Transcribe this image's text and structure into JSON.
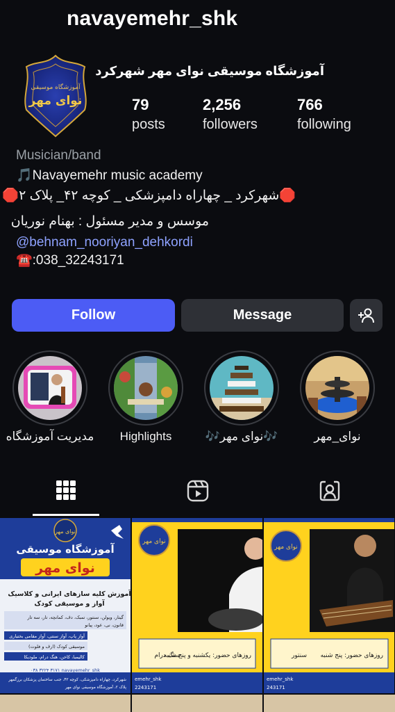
{
  "profile": {
    "username": "navayemehr_shk",
    "full_name": "آموزشگاه موسیقی نوای مهر شهرکرد",
    "avatar_text": "آموزشگاه موسیقی نوای مهر",
    "stats": [
      {
        "value": "79",
        "label": "posts"
      },
      {
        "value": "2,256",
        "label": "followers"
      },
      {
        "value": "766",
        "label": "following"
      }
    ]
  },
  "bio": {
    "category": "Musician/band",
    "line1": "🎵Navayemehr music academy",
    "line2": "🛑شهرکرد _ چهاراه دامپزشکی _ کوچه ۴۲_ پلاک ۲🛑",
    "line3": "موسس و مدیر مسئول : بهنام نوریان",
    "mention": "@behnam_nooriyan_dehkordi",
    "phone": "☎️:038_32243171"
  },
  "actions": {
    "follow": "Follow",
    "message": "Message"
  },
  "highlights": [
    {
      "label": "مدیریت آموزشگاه"
    },
    {
      "label": "Highlights"
    },
    {
      "label": "🎶نوای مهر🎶"
    },
    {
      "label": "نوای_مهر"
    }
  ],
  "posts": [
    {
      "logo": "نوای مهر",
      "title1": "آموزشگاه موسیقی",
      "title2": "نوای مهر",
      "subtitle1": "آموزش کلیه سازهای ایرانی و کلاسیک",
      "subtitle2": "آواز و موسیقی کودک",
      "list1": "گیتار، ویولن، سنتور، تمبک، دف، کمانچه، تار، سه تار",
      "list2": "قانون، نی، عود، پیانو",
      "list3": "آواز پاپ، آواز سنتی، آواز مقامی بختیاری",
      "list4": "موسیقی کودک (ارف و فلوت)",
      "list5": "کالیمبا، کاخن، هنگ درام، ملودیکا",
      "footer1": "۰۳۸ ۳۲۲۴ ۳۱۷۱ navayemehr_shk",
      "footer2": "شهرکرد، چهاراه دامپزشکی، کوچه ۴۲، جنب ساختمان پزشکان برزگمهر",
      "footer3": "پلاک ۲، آموزشگاه موسیقی نوای مهر"
    },
    {
      "logo": "نوای مهر",
      "caption": "روزهای حضور: یکشنبه و پنج شنبه",
      "caption2": "سنگ درام",
      "footer1": "emehr_shk",
      "footer2": "2243171"
    },
    {
      "logo": "نوای مهر",
      "caption": "روزهای حضور: پنج شنبه",
      "caption2": "سنتور",
      "footer1": "emehr_shk",
      "footer2": "243171"
    }
  ],
  "colors": {
    "background": "#0b0c10",
    "follow": "#4c5cf5",
    "secondary_button": "#2e3036",
    "mention": "#8ea2ff",
    "post_yellow": "#ffd21e",
    "post_blue": "#1d3a8f"
  }
}
